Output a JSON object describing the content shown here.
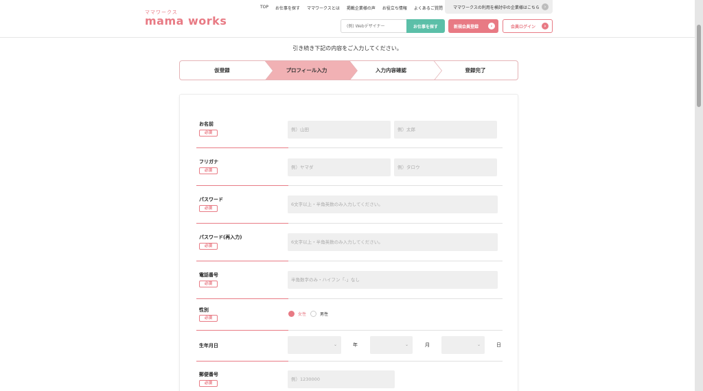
{
  "header": {
    "logo_sub": "ママワークス",
    "logo_main": "mama works",
    "nav": [
      "TOP",
      "お仕事を探す",
      "ママワークスとは",
      "掲載企業様の声",
      "お役立ち情報",
      "よくあるご質問"
    ],
    "company_link": "ママワークスの利用を検討中の企業様はこちら",
    "search_placeholder": "(例) Webデザイナー",
    "search_button": "お仕事を探す",
    "register_button": "新規会員登録",
    "login_button": "会員ログイン"
  },
  "instruction": "引き続き下記の内容をご入力してください。",
  "steps": [
    {
      "label": "仮登録",
      "active": false
    },
    {
      "label": "プロフィール入力",
      "active": true
    },
    {
      "label": "入力内容確認",
      "active": false
    },
    {
      "label": "登録完了",
      "active": false
    }
  ],
  "required_badge": "必須",
  "form": {
    "name": {
      "label": "お名前",
      "last_placeholder": "例）山田",
      "first_placeholder": "例）太郎"
    },
    "kana": {
      "label": "フリガナ",
      "last_placeholder": "例）ヤマダ",
      "first_placeholder": "例）タロウ"
    },
    "password": {
      "label": "パスワード",
      "placeholder": "6文字以上・半角英数のみ入力してください。"
    },
    "password_confirm": {
      "label": "パスワード(再入力)",
      "placeholder": "6文字以上・半角英数のみ入力してください。"
    },
    "phone": {
      "label": "電話番号",
      "placeholder": "半角数字のみ・ハイフン「-」なし"
    },
    "gender": {
      "label": "性別",
      "options": [
        "女性",
        "男性"
      ],
      "selected": "女性"
    },
    "birthday": {
      "label": "生年月日",
      "year_unit": "年",
      "month_unit": "月",
      "day_unit": "日"
    },
    "postal": {
      "label": "郵便番号",
      "placeholder": "例）1230000"
    }
  },
  "colors": {
    "accent": "#e87a84",
    "search_green": "#5bbfa8",
    "step_active": "#f1b1b4"
  },
  "icons": {
    "arrow": "chevron-right-circle-icon",
    "select": "chevron-down-icon"
  }
}
